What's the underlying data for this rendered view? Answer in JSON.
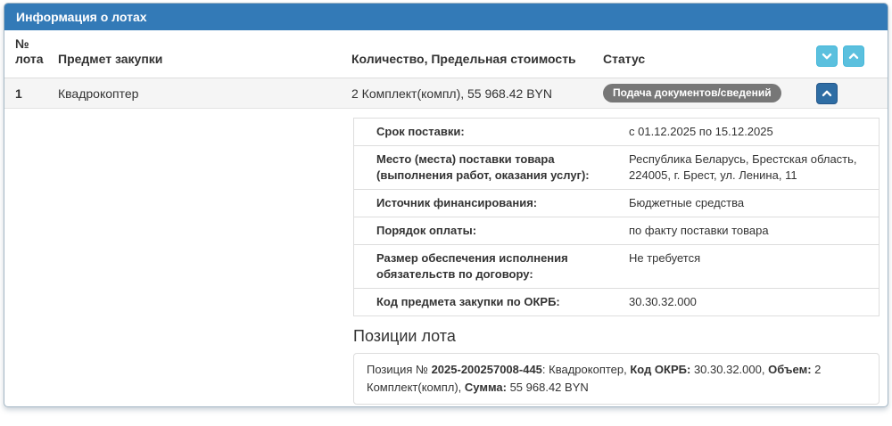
{
  "panel": {
    "title": "Информация о лотах"
  },
  "colors": {
    "header_bg": "#337ab7",
    "expand_buttons_bg": "#5bc0de",
    "row_collapse_button_bg": "#2e6da4",
    "status_badge_bg": "#777777",
    "row_stripe_bg": "#f5f5f5"
  },
  "icons": {
    "expand_all": "chevron-down",
    "collapse_all": "chevron-up",
    "row_collapse": "chevron-up"
  },
  "table": {
    "headers": {
      "num": "№ лота",
      "subject": "Предмет закупки",
      "quantity": "Количество, Предельная стоимость",
      "status": "Статус"
    },
    "row": {
      "num": "1",
      "subject": "Квадрокоптер",
      "quantity": "2 Комплект(компл), 55 968.42 BYN",
      "status": "Подача документов/сведений"
    }
  },
  "details": {
    "rows": [
      {
        "label": "Срок поставки:",
        "value": "с 01.12.2025 по 15.12.2025"
      },
      {
        "label": "Место (места) поставки товара (выполнения работ, оказания услуг):",
        "value": "Республика Беларусь, Брестская область, 224005, г. Брест, ул. Ленина, 11"
      },
      {
        "label": "Источник финансирования:",
        "value": "Бюджетные средства"
      },
      {
        "label": "Порядок оплаты:",
        "value": "по факту поставки товара"
      },
      {
        "label": "Размер обеспечения исполнения обязательств по договору:",
        "value": "Не требуется"
      },
      {
        "label": "Код предмета закупки по ОКРБ:",
        "value": "30.30.32.000"
      }
    ]
  },
  "positions": {
    "heading": "Позиции лота",
    "line": {
      "segments": [
        {
          "text": "Позиция № ",
          "bold": false
        },
        {
          "text": "2025-200257008-445",
          "bold": true
        },
        {
          "text": ": Квадрокоптер, ",
          "bold": false
        },
        {
          "text": "Код ОКРБ:",
          "bold": true
        },
        {
          "text": " 30.30.32.000, ",
          "bold": false
        },
        {
          "text": "Объем:",
          "bold": true
        },
        {
          "text": " 2 Комплект(компл), ",
          "bold": false
        },
        {
          "text": "Сумма:",
          "bold": true
        },
        {
          "text": " 55 968.42 BYN",
          "bold": false
        }
      ]
    }
  }
}
